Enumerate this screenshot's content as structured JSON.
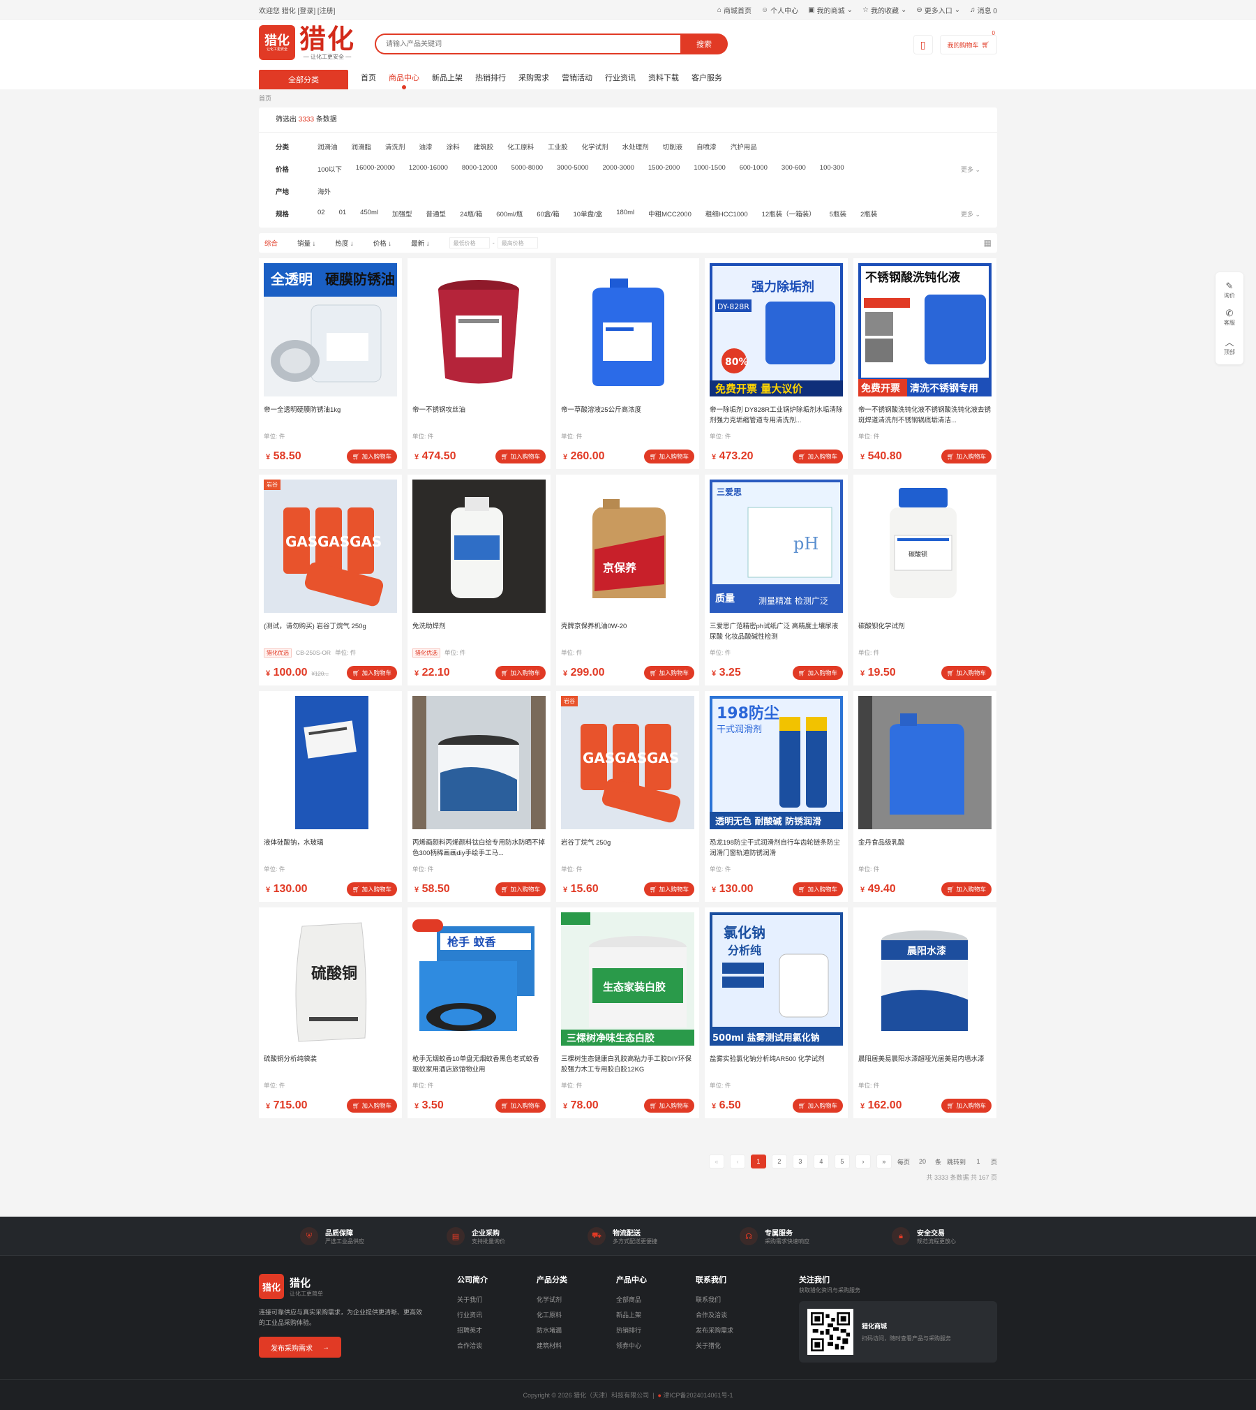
{
  "topbar": {
    "welcome": "欢迎您 猎化 [登录] [注册]",
    "links": [
      "商城首页",
      "个人中心",
      "我的商城",
      "我的收藏",
      "更多入口",
      "消息 0"
    ]
  },
  "header": {
    "logo_big": "猎化",
    "logo_small": "让化工更安全",
    "logo_text": "猎化",
    "slogan": "— 让化工更安全 —",
    "search_placeholder": "请输入产品关键词",
    "search_button": "搜索",
    "cart_label": "我的购物车",
    "cart_count": "0"
  },
  "nav": {
    "all": "全部分类",
    "items": [
      "首页",
      "商品中心",
      "新品上架",
      "热销排行",
      "采购需求",
      "营销活动",
      "行业资讯",
      "资料下载",
      "客户服务"
    ]
  },
  "breadcrumb": "首页",
  "filter": {
    "count_prefix": "筛选出",
    "count": "3333",
    "count_suffix": "条数据",
    "rows": [
      {
        "label": "分类",
        "options": [
          "润滑油",
          "润滑脂",
          "清洗剂",
          "油漆",
          "涂料",
          "建筑胶",
          "化工原料",
          "工业胶",
          "化学试剂",
          "水处理剂",
          "切削液",
          "自喷漆",
          "汽护用品"
        ],
        "more": ""
      },
      {
        "label": "价格",
        "options": [
          "100以下",
          "16000-20000",
          "12000-16000",
          "8000-12000",
          "5000-8000",
          "3000-5000",
          "2000-3000",
          "1500-2000",
          "1000-1500",
          "600-1000",
          "300-600",
          "100-300"
        ],
        "more": "更多"
      },
      {
        "label": "产地",
        "options": [
          "海外"
        ],
        "more": ""
      },
      {
        "label": "规格",
        "options": [
          "02",
          "01",
          "450ml",
          "加强型",
          "普通型",
          "24瓶/箱",
          "600ml/瓶",
          "60盒/箱",
          "10单盘/盒",
          "180ml",
          "中粗MCC2000",
          "粗细HCC1000",
          "12瓶装（一箱装）",
          "5瓶装",
          "2瓶装"
        ],
        "more": "更多"
      }
    ]
  },
  "sort": {
    "items": [
      "综合",
      "销量 ↓",
      "热度 ↓",
      "价格 ↓",
      "最新 ↓"
    ],
    "min_price": "最低价格",
    "max_price": "最高价格"
  },
  "products": [
    {
      "name": "帝一全透明硬膜防锈油1kg",
      "unit": "单位: 件",
      "price": "58.50",
      "img": "clear-oil",
      "badge": "",
      "old": ""
    },
    {
      "name": "帝一不锈钢攻丝油",
      "unit": "单位: 件",
      "price": "474.50",
      "img": "red-bucket",
      "badge": "",
      "old": ""
    },
    {
      "name": "帝一草酸溶液25公斤高浓度",
      "unit": "单位: 件",
      "price": "260.00",
      "img": "blue-jug",
      "badge": "",
      "old": ""
    },
    {
      "name": "帝一除垢剂 DY828R工业锅炉除垢剂水垢清除剂强力克垢缩管道专用清洗剂...",
      "unit": "单位: 件",
      "price": "473.20",
      "img": "descaler",
      "badge": "",
      "old": ""
    },
    {
      "name": "帝一不锈钢酸洗钝化液不锈钢酸洗钝化液去锈斑焊道清洗剂不锈钢锅底垢清洁...",
      "unit": "单位: 件",
      "price": "540.80",
      "img": "passivation",
      "badge": "",
      "old": ""
    },
    {
      "name": "(测试，请勿购买) 岩谷丁烷气 250g",
      "unit": "单位: 件",
      "price": "100.00",
      "img": "gas",
      "badge": "猎化优选",
      "sku": "CB-250S-OR",
      "old": "¥120..."
    },
    {
      "name": "免洗助焊剂",
      "unit": "单位: 件",
      "price": "22.10",
      "img": "bottle-white",
      "badge": "猎化优选",
      "old": ""
    },
    {
      "name": "壳牌京保养机油0W-20",
      "unit": "单位: 件",
      "price": "299.00",
      "img": "engine-oil",
      "badge": "",
      "old": ""
    },
    {
      "name": "三爱思广范精密ph试纸广泛 高精度土壤尿液尿酸 化妆品酸碱性检测",
      "unit": "单位: 件",
      "price": "3.25",
      "img": "ph-paper",
      "badge": "",
      "old": ""
    },
    {
      "name": "碳酸钡化学试剂",
      "unit": "单位: 件",
      "price": "19.50",
      "img": "reagent-jar",
      "badge": "",
      "old": ""
    },
    {
      "name": "液体硅酸钠，水玻璃",
      "unit": "单位: 件",
      "price": "130.00",
      "img": "blue-drum",
      "badge": "",
      "old": ""
    },
    {
      "name": "丙烯画颜料丙烯颜料钛白绘专用防水防晒不掉色300柄稀画画diy手绘手工马...",
      "unit": "单位: 件",
      "price": "58.50",
      "img": "paint-tub",
      "badge": "",
      "old": ""
    },
    {
      "name": "岩谷丁烷气 250g",
      "unit": "单位: 件",
      "price": "15.60",
      "img": "gas",
      "badge": "",
      "old": ""
    },
    {
      "name": "恐龙198防尘干式润滑剂自行车齿轮链条防尘润滑门窗轨道防锈润滑",
      "unit": "单位: 件",
      "price": "130.00",
      "img": "spray",
      "badge": "",
      "old": ""
    },
    {
      "name": "金丹食品级乳酸",
      "unit": "单位: 件",
      "price": "49.40",
      "img": "blue-can",
      "badge": "",
      "old": ""
    },
    {
      "name": "硫酸铜分析纯袋装",
      "unit": "单位: 件",
      "price": "715.00",
      "img": "sack",
      "badge": "",
      "old": ""
    },
    {
      "name": "枪手无烟蚊香10单盘无烟蚊香黑色老式蚊香驱蚊家用酒店旅馆物业用",
      "unit": "单位: 件",
      "price": "3.50",
      "img": "mosquito",
      "badge": "",
      "old": ""
    },
    {
      "name": "三棵树生态健康白乳胶高粘力手工胶DIY环保胶强力木工专用胶白胶12KG",
      "unit": "单位: 件",
      "price": "78.00",
      "img": "glue",
      "badge": "",
      "old": ""
    },
    {
      "name": "盐雾实验氯化钠分析纯AR500 化学试剂",
      "unit": "单位: 件",
      "price": "6.50",
      "img": "nacl",
      "badge": "",
      "old": ""
    },
    {
      "name": "晨阳居美易晨阳水漆超哑光居美易内墙水漆",
      "unit": "单位: 件",
      "price": "162.00",
      "img": "paint-bucket",
      "badge": "",
      "old": ""
    }
  ],
  "product_labels": {
    "add_cart": "加入购物车",
    "currency": "¥"
  },
  "pager": {
    "pages": [
      "1",
      "2",
      "3",
      "4",
      "5"
    ],
    "per_page_label": "每页",
    "per_page": "20",
    "per_page_unit": "条",
    "jump_label": "跳转到",
    "jump_value": "1",
    "page_unit": "页",
    "summary": "共 3333 条数据   共 167 页"
  },
  "side_tools": [
    "询价",
    "客服",
    "顶部"
  ],
  "footer": {
    "features": [
      {
        "title": "品质保障",
        "desc": "严选工业品供应"
      },
      {
        "title": "企业采购",
        "desc": "支持批量询价"
      },
      {
        "title": "物流配送",
        "desc": "多方式配送更便捷"
      },
      {
        "title": "专属服务",
        "desc": "采购需求快速响应"
      },
      {
        "title": "安全交易",
        "desc": "规范流程更放心"
      }
    ],
    "brand_name": "猎化",
    "brand_slogan": "让化工更简单",
    "brand_desc": "连接可靠供应与真实采购需求，为企业提供更清晰、更高效的工业品采购体验。",
    "publish_btn": "发布采购需求",
    "columns": [
      {
        "title": "公司简介",
        "items": [
          "关于我们",
          "行业资讯",
          "招聘英才",
          "合作洽谈"
        ]
      },
      {
        "title": "产品分类",
        "items": [
          "化学试剂",
          "化工原料",
          "防水堵漏",
          "建筑材料"
        ]
      },
      {
        "title": "产品中心",
        "items": [
          "全部商品",
          "新品上架",
          "热销排行",
          "领券中心"
        ]
      },
      {
        "title": "联系我们",
        "items": [
          "联系我们",
          "合作及洽谈",
          "发布采购需求",
          "关于猎化"
        ]
      }
    ],
    "follow_title": "关注我们",
    "follow_sub": "获取猎化资讯与采购服务",
    "qr_title": "猎化商城",
    "qr_desc": "扫码访问，随时查看产品与采购服务",
    "copyright": "Copyright © 2026 猎化（天津）科技有限公司",
    "icp": "津ICP备2024014061号-1"
  }
}
